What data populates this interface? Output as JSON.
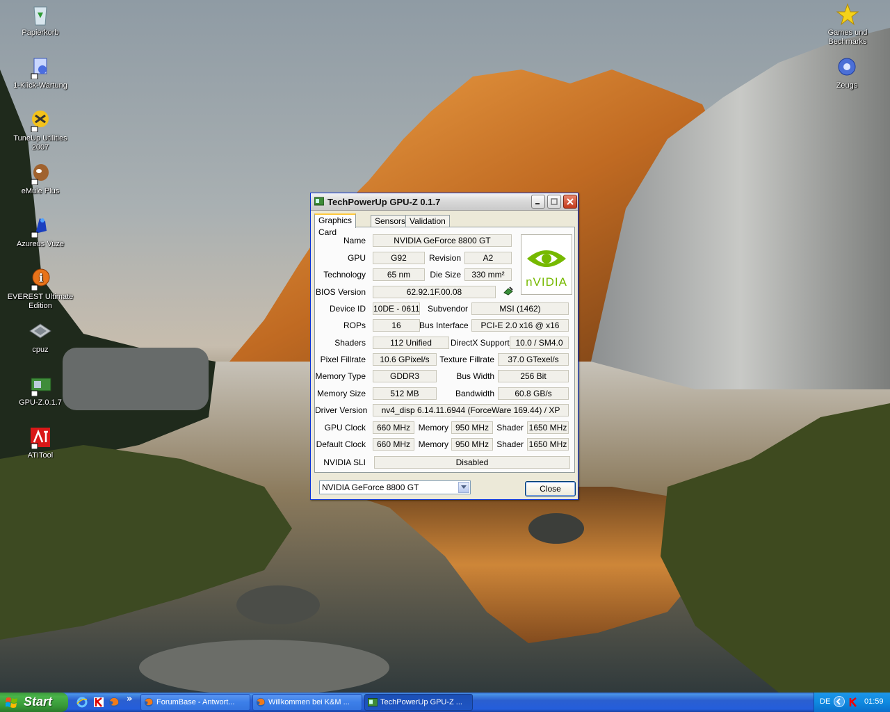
{
  "desktop_icons": [
    {
      "id": "recycle",
      "label": "Papierkorb"
    },
    {
      "id": "oneclick",
      "label": "1-Klick-Wartung"
    },
    {
      "id": "tuneup",
      "label": "TuneUp Utilities 2007"
    },
    {
      "id": "emule",
      "label": "eMule Plus"
    },
    {
      "id": "azureus",
      "label": "Azureus Vuze"
    },
    {
      "id": "everest",
      "label": "EVEREST Ultimate Edition"
    },
    {
      "id": "cpuz",
      "label": "cpuz"
    },
    {
      "id": "gpuz",
      "label": "GPU-Z.0.1.7"
    },
    {
      "id": "atitool",
      "label": "ATITool"
    },
    {
      "id": "games",
      "label": "Games und Bechmarks"
    },
    {
      "id": "zeugs",
      "label": "Zeugs"
    }
  ],
  "window": {
    "title": "TechPowerUp GPU-Z 0.1.7",
    "tabs": [
      "Graphics Card",
      "Sensors",
      "Validation"
    ],
    "logo_text": "nVIDIA",
    "labels": {
      "name": "Name",
      "gpu": "GPU",
      "revision": "Revision",
      "technology": "Technology",
      "die_size": "Die Size",
      "bios": "BIOS Version",
      "device_id": "Device ID",
      "subvendor": "Subvendor",
      "rops": "ROPs",
      "bus_interface": "Bus Interface",
      "shaders": "Shaders",
      "directx": "DirectX Support",
      "pixel_fillrate": "Pixel Fillrate",
      "texture_fillrate": "Texture Fillrate",
      "memory_type": "Memory Type",
      "bus_width": "Bus Width",
      "memory_size": "Memory Size",
      "bandwidth": "Bandwidth",
      "driver": "Driver Version",
      "gpu_clock": "GPU Clock",
      "memory": "Memory",
      "shader": "Shader",
      "default_clock": "Default Clock",
      "sli": "NVIDIA SLI"
    },
    "values": {
      "name": "NVIDIA GeForce 8800 GT",
      "gpu": "G92",
      "revision": "A2",
      "technology": "65 nm",
      "die_size": "330 mm²",
      "bios": "62.92.1F.00.08",
      "device_id": "10DE - 0611",
      "subvendor": "MSI (1462)",
      "rops": "16",
      "bus_interface": "PCI-E 2.0 x16 @ x16",
      "shaders": "112 Unified",
      "directx": "10.0 / SM4.0",
      "pixel_fillrate": "10.6 GPixel/s",
      "texture_fillrate": "37.0 GTexel/s",
      "memory_type": "GDDR3",
      "bus_width": "256 Bit",
      "memory_size": "512 MB",
      "bandwidth": "60.8 GB/s",
      "driver": "nv4_disp 6.14.11.6944 (ForceWare 169.44) / XP",
      "gpu_clock": "660 MHz",
      "gpu_memory": "950 MHz",
      "gpu_shader": "1650 MHz",
      "default_clock": "660 MHz",
      "default_memory": "950 MHz",
      "default_shader": "1650 MHz",
      "sli": "Disabled"
    },
    "device_select": "NVIDIA GeForce 8800 GT",
    "close_label": "Close"
  },
  "taskbar": {
    "start_label": "Start",
    "chevron": "»",
    "items": [
      {
        "label": "ForumBase - Antwort..."
      },
      {
        "label": "Willkommen bei K&M ..."
      },
      {
        "label": "TechPowerUp GPU-Z ..."
      }
    ],
    "lang": "DE",
    "clock": "01:59"
  }
}
